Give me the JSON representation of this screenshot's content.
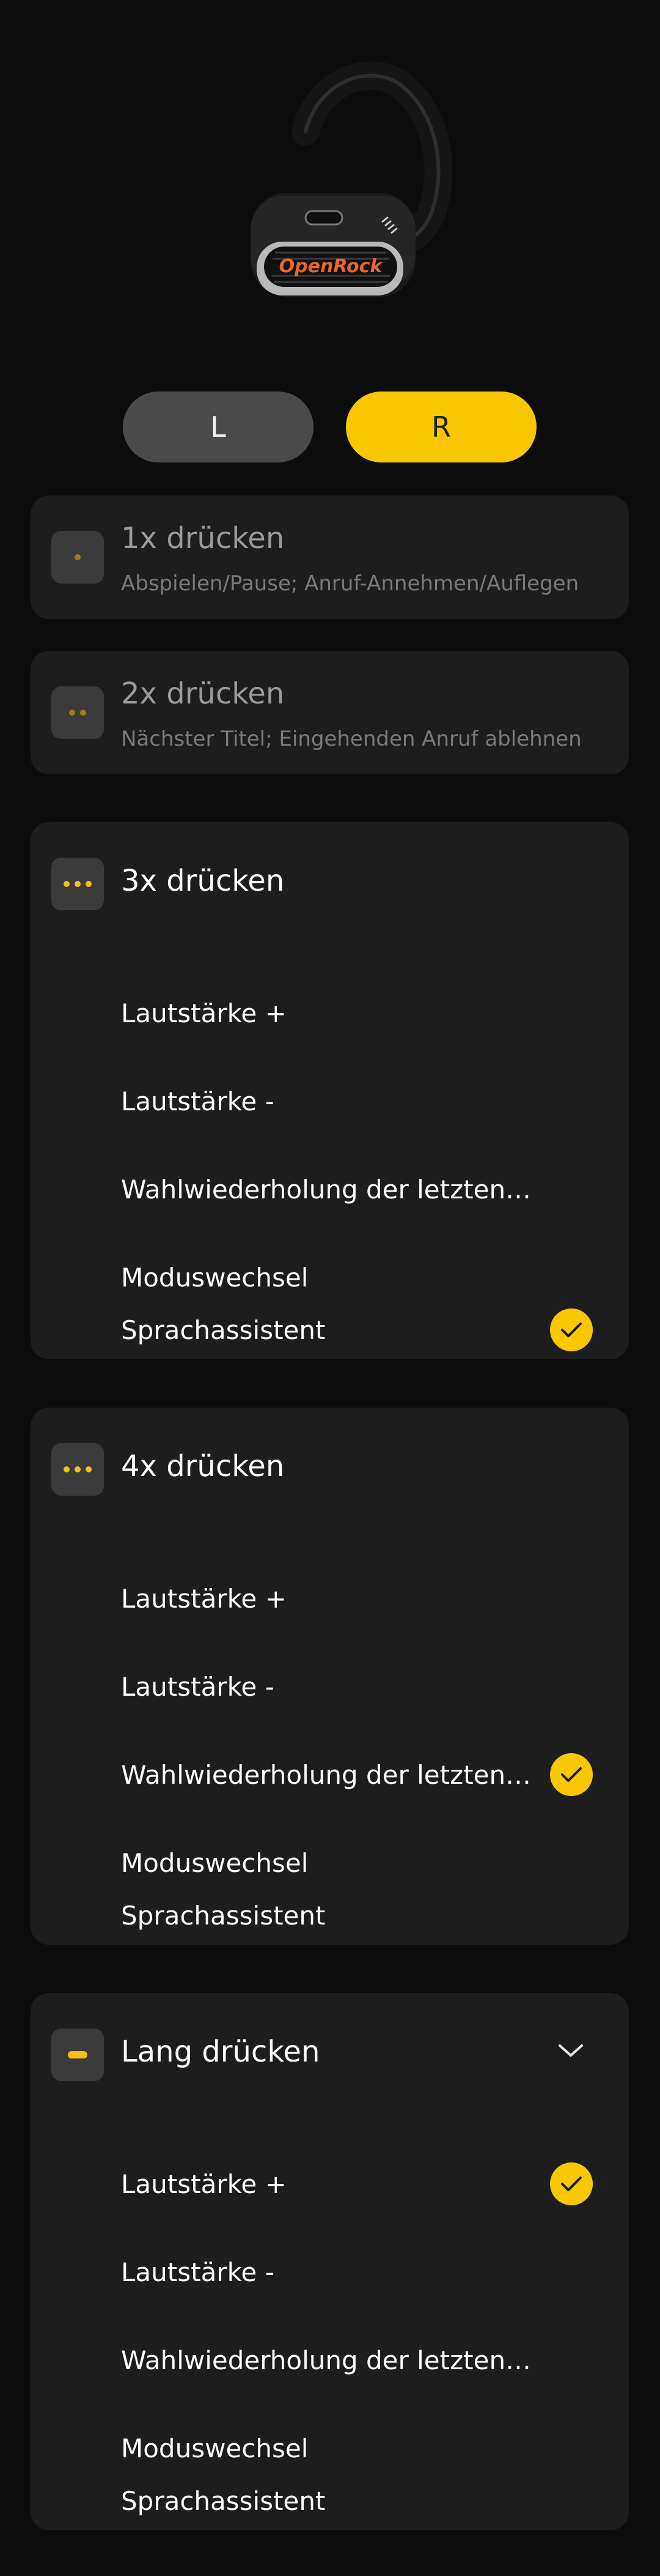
{
  "device": {
    "brand_text": "OpenRock"
  },
  "sides": {
    "left": "L",
    "right": "R",
    "selected": "R"
  },
  "cards": [
    {
      "title": "1x drücken",
      "subtitle": "Abspielen/Pause; Anruf-Annehmen/Auflegen",
      "icon": "one-dot-icon"
    },
    {
      "title": "2x drücken",
      "subtitle": "Nächster Titel; Eingehenden Anruf ablehnen",
      "icon": "two-dots-icon"
    },
    {
      "title": "3x drücken",
      "icon": "three-dots-icon",
      "options": [
        "Lautstärke +",
        "Lautstärke -",
        "Wahlwiederholung der letzten…",
        "Moduswechsel",
        "Sprachassistent"
      ],
      "selected": "Sprachassistent"
    },
    {
      "title": "4x drücken",
      "icon": "three-dots-icon",
      "options": [
        "Lautstärke +",
        "Lautstärke -",
        "Wahlwiederholung der letzten…",
        "Moduswechsel",
        "Sprachassistent"
      ],
      "selected": "Wahlwiederholung der letzten…"
    },
    {
      "title": "Lang drücken",
      "icon": "dash-icon",
      "expanded": true,
      "options": [
        "Lautstärke +",
        "Lautstärke -",
        "Wahlwiederholung der letzten…",
        "Moduswechsel",
        "Sprachassistent"
      ],
      "selected": "Lautstärke +"
    }
  ],
  "colors": {
    "accent": "#f9c700",
    "card_bg": "#1d1d1d",
    "page_bg": "#0c0c0c",
    "toggle_inactive": "#4a4a4a"
  }
}
